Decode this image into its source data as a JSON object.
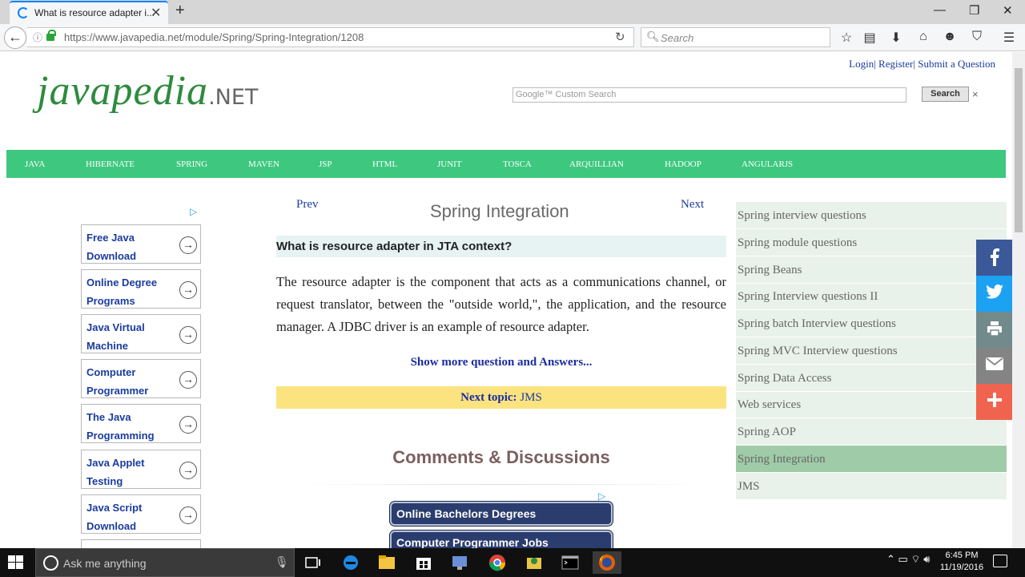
{
  "browser": {
    "tab_title": "What is resource adapter i...",
    "url": "https://www.javapedia.net/module/Spring/Spring-Integration/1208",
    "search_placeholder": "Search"
  },
  "header": {
    "links": "Login| Register| Submit a Question",
    "logo_main": "javapedia",
    "logo_suffix": ".NET",
    "gsearch_placeholder": "Google™ Custom Search",
    "gsearch_button": "Search",
    "gsearch_clear": "×"
  },
  "menu": [
    "JAVA",
    "HIBERNATE",
    "SPRING",
    "MAVEN",
    "JSP",
    "HTML",
    "JUNIT",
    "TOSCA",
    "ARQUILLIAN",
    "HADOOP",
    "ANGULARJS"
  ],
  "ads_left": [
    {
      "label": "Free Java Download"
    },
    {
      "label": "Online Degree Programs"
    },
    {
      "label": "Java Virtual Machine"
    },
    {
      "label": "Computer Programmer"
    },
    {
      "label": "The Java Programming"
    },
    {
      "label": "Java Applet Testing"
    },
    {
      "label": "Java Script Download"
    }
  ],
  "content": {
    "prev": "Prev",
    "next": "Next",
    "title": "Spring Integration",
    "question": "What is resource adapter in JTA context?",
    "answer": "The resource adapter is the component that acts as a communications channel, or request translator, between the \"outside world,\", the application, and the resource manager. A JDBC driver is an example of resource adapter.",
    "show_more": "Show more question and Answers...",
    "next_topic_label": "Next topic:",
    "next_topic_value": "JMS",
    "comments_heading": "Comments & Discussions",
    "ad_pills": [
      "Online Bachelors Degrees",
      "Computer Programmer Jobs"
    ]
  },
  "sidebar": {
    "items": [
      "Spring interview questions",
      "Spring module questions",
      "Spring Beans",
      "Spring Interview questions II",
      "Spring batch Interview questions",
      "Spring MVC Interview questions",
      "Spring Data Access",
      "Web services",
      "Spring AOP",
      "Spring Integration",
      "JMS"
    ],
    "active_index": 9
  },
  "share_colors": {
    "facebook": "#3b5998",
    "twitter": "#1da1f2",
    "print": "#738a8d",
    "email": "#848484",
    "more": "#f0644f"
  },
  "taskbar": {
    "search_placeholder": "Ask me anything",
    "time": "6:45 PM",
    "date": "11/19/2016"
  }
}
